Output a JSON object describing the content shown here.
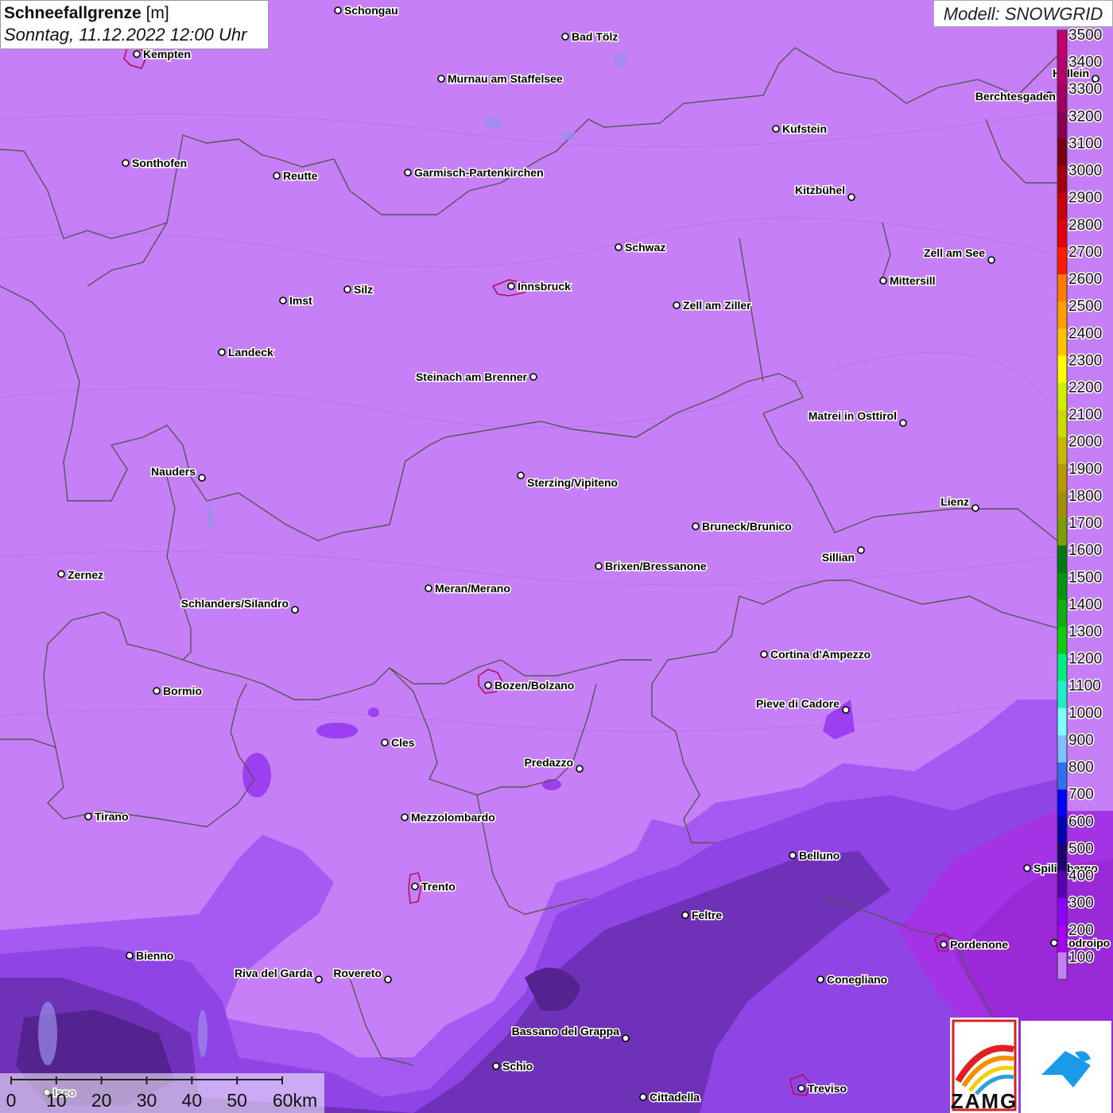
{
  "header": {
    "title": "Schneefallgrenze",
    "unit": "[m]",
    "datetime": "Sonntag, 11.12.2022 12:00 Uhr",
    "model": "Modell: SNOWGRID"
  },
  "colors": {
    "background": "#c77ff7",
    "low_zone": "#9b3ff0",
    "deep_zone": "#6a2aa8",
    "border": "#555555",
    "city_outline": "#b01060"
  },
  "legend": {
    "levels": [
      "3500",
      "3400",
      "3300",
      "3200",
      "3100",
      "3000",
      "2900",
      "2800",
      "2700",
      "2600",
      "2500",
      "2400",
      "2300",
      "2200",
      "2100",
      "2000",
      "1900",
      "1800",
      "1700",
      "1600",
      "1500",
      "1400",
      "1300",
      "1200",
      "1100",
      "1000",
      "900",
      "800",
      "700",
      "600",
      "500",
      "400",
      "300",
      "200",
      "100"
    ],
    "colors": [
      "#c2006e",
      "#b3006a",
      "#a10062",
      "#880052",
      "#7a0010",
      "#a30010",
      "#c8000e",
      "#e4000b",
      "#ff1a00",
      "#ff7a00",
      "#ff9f00",
      "#ffc400",
      "#ffff00",
      "#ccf000",
      "#c8dc00",
      "#c8b800",
      "#b89a00",
      "#a0900a",
      "#78a000",
      "#007a10",
      "#00960a",
      "#10b010",
      "#10cc10",
      "#00ee80",
      "#20f0c8",
      "#80ffff",
      "#7fc0f8",
      "#3070f0",
      "#0000ff",
      "#0000b0",
      "#200070",
      "#5a00b0",
      "#8c00ff",
      "#a600f0",
      "#c77ff7"
    ]
  },
  "cities": [
    {
      "name": "Schongau"
    },
    {
      "name": "Bad Tölz"
    },
    {
      "name": "Kempten"
    },
    {
      "name": "Murnau am Staffelsee"
    },
    {
      "name": "Hallein"
    },
    {
      "name": "Berchtesgaden"
    },
    {
      "name": "Kufstein"
    },
    {
      "name": "Sonthofen"
    },
    {
      "name": "Reutte"
    },
    {
      "name": "Garmisch-Partenkirchen"
    },
    {
      "name": "Kitzbühel"
    },
    {
      "name": "Schwaz"
    },
    {
      "name": "Zell am See"
    },
    {
      "name": "Innsbruck"
    },
    {
      "name": "Mittersill"
    },
    {
      "name": "Imst"
    },
    {
      "name": "Silz"
    },
    {
      "name": "Zell am Ziller"
    },
    {
      "name": "Landeck"
    },
    {
      "name": "Steinach am Brenner"
    },
    {
      "name": "Matrei in Osttirol"
    },
    {
      "name": "Nauders"
    },
    {
      "name": "Sterzing/Vipiteno"
    },
    {
      "name": "Lienz"
    },
    {
      "name": "Bruneck/Brunico"
    },
    {
      "name": "Sillian"
    },
    {
      "name": "Zernez"
    },
    {
      "name": "Brixen/Bressanone"
    },
    {
      "name": "Meran/Merano"
    },
    {
      "name": "Schlanders/Silandro"
    },
    {
      "name": "Cortina d'Ampezzo"
    },
    {
      "name": "Bormio"
    },
    {
      "name": "Bozen/Bolzano"
    },
    {
      "name": "Pieve di Cadore"
    },
    {
      "name": "Cles"
    },
    {
      "name": "Predazzo"
    },
    {
      "name": "Tirano"
    },
    {
      "name": "Mezzolombardo"
    },
    {
      "name": "Belluno"
    },
    {
      "name": "Spilimbergo"
    },
    {
      "name": "Trento"
    },
    {
      "name": "Feltre"
    },
    {
      "name": "Pordenone"
    },
    {
      "name": "Codroipo"
    },
    {
      "name": "Bienno"
    },
    {
      "name": "Riva del Garda"
    },
    {
      "name": "Rovereto"
    },
    {
      "name": "Conegliano"
    },
    {
      "name": "Bassano del Grappa"
    },
    {
      "name": "Schio"
    },
    {
      "name": "Iseo"
    },
    {
      "name": "Treviso"
    },
    {
      "name": "Cittadella"
    }
  ],
  "scale": {
    "ticks": [
      "0",
      "10",
      "20",
      "30",
      "40",
      "50",
      "60km"
    ]
  },
  "logos": {
    "zamg_text": "ZAMG"
  }
}
